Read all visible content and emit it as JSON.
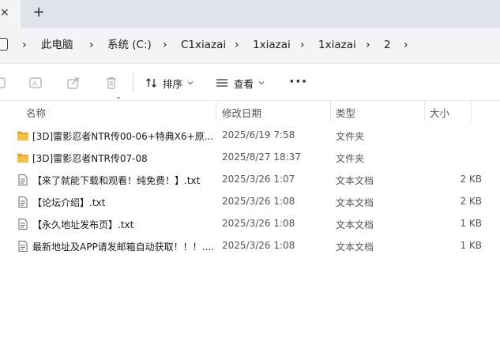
{
  "tabstrip": {
    "close_glyph": "×",
    "newtab_glyph": "+"
  },
  "breadcrumb": {
    "items": [
      "此电脑",
      "系统 (C:)",
      "C1xiazai",
      "1xiazai",
      "1xiazai",
      "2"
    ]
  },
  "toolbar": {
    "sort_label": "排序",
    "view_label": "查看",
    "more_glyph": "···"
  },
  "columns": {
    "name": "名称",
    "modified": "修改日期",
    "type": "类型",
    "size": "大小"
  },
  "files": [
    {
      "name": "[3D]雷影忍者NTR传00-06+特典X6+原...",
      "modified": "2025/6/19 7:58",
      "type": "文件夹",
      "size": "",
      "icon": "folder-icon"
    },
    {
      "name": "[3D]雷影忍者NTR传07-08",
      "modified": "2025/8/27 18:37",
      "type": "文件夹",
      "size": "",
      "icon": "folder-icon"
    },
    {
      "name": "【来了就能下载和观看！纯免费！】.txt",
      "modified": "2025/3/26 1:07",
      "type": "文本文档",
      "size": "2 KB",
      "icon": "text-file-icon"
    },
    {
      "name": "【论坛介绍】.txt",
      "modified": "2025/3/26 1:08",
      "type": "文本文档",
      "size": "2 KB",
      "icon": "text-file-icon"
    },
    {
      "name": "【永久地址发布页】.txt",
      "modified": "2025/3/26 1:08",
      "type": "文本文档",
      "size": "1 KB",
      "icon": "text-file-icon"
    },
    {
      "name": "最新地址及APP请发邮箱自动获取！！！....",
      "modified": "2025/3/26 1:08",
      "type": "文本文档",
      "size": "1 KB",
      "icon": "text-file-icon"
    }
  ],
  "colors": {
    "folder": "#f2c04a",
    "folder_dark": "#e0a92a",
    "toolbar_disabled": "#b4b8be"
  }
}
